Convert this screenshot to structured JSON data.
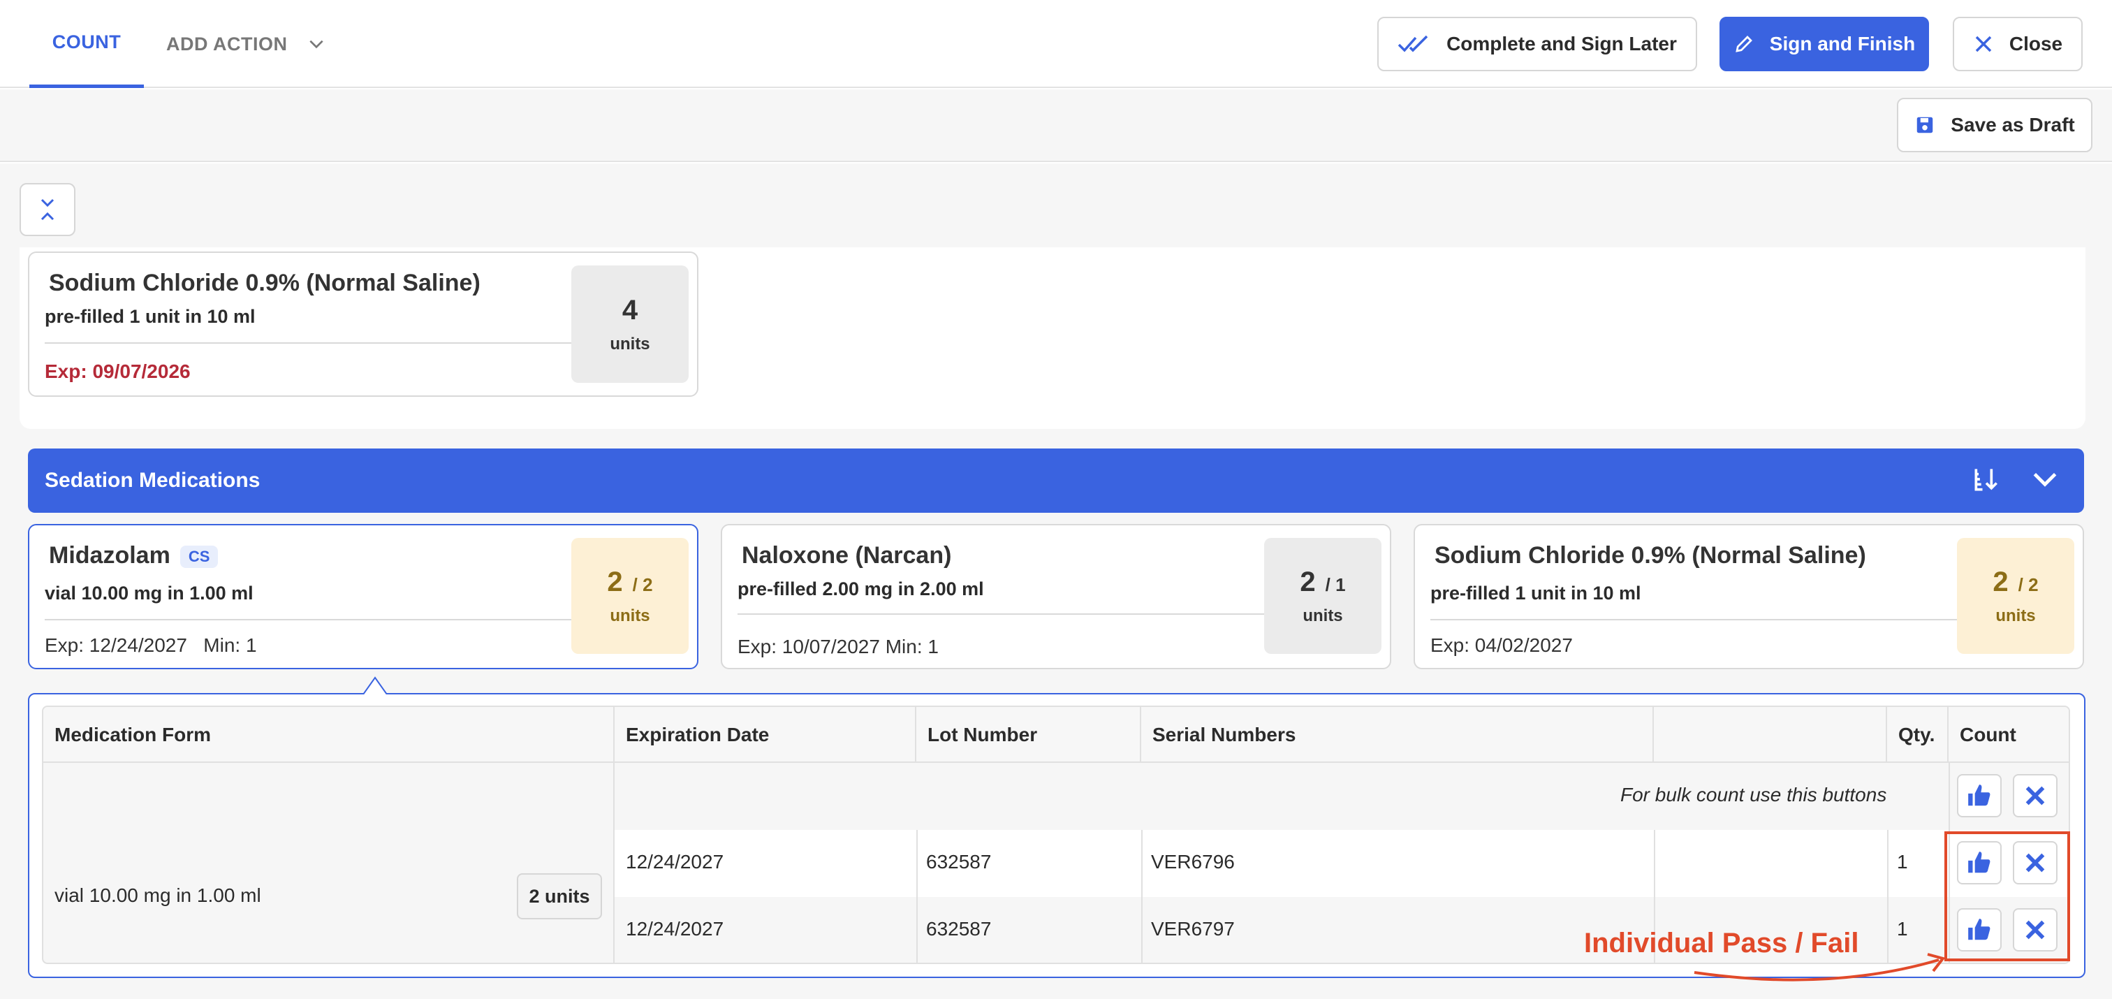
{
  "header": {
    "tabs": [
      {
        "label": "COUNT"
      },
      {
        "label": "ADD ACTION"
      }
    ],
    "complete_sign_later": "Complete and Sign Later",
    "sign_finish": "Sign and Finish",
    "close": "Close",
    "save_draft": "Save as Draft"
  },
  "top_card": {
    "name": "Sodium Chloride 0.9% (Normal Saline)",
    "form": "pre-filled 1 unit in 10 ml",
    "exp": "Exp: 09/07/2026",
    "count": "4",
    "unit_label": "units"
  },
  "section": {
    "title": "Sedation Medications"
  },
  "cards": [
    {
      "name": "Midazolam",
      "badge": "CS",
      "form": "vial 10.00 mg in 1.00 ml",
      "exp": "Exp: 12/24/2027   Min: 1",
      "count": "2",
      "of": "/ 2",
      "unit_label": "units"
    },
    {
      "name": "Naloxone (Narcan)",
      "form": "pre-filled 2.00 mg in 2.00 ml",
      "exp": "Exp: 10/07/2027 Min: 1",
      "count": "2",
      "of": "/ 1",
      "unit_label": "units"
    },
    {
      "name": "Sodium Chloride 0.9% (Normal Saline)",
      "form": "pre-filled 1 unit in 10 ml",
      "exp": "Exp: 04/02/2027",
      "count": "2",
      "of": "/ 2",
      "unit_label": "units"
    }
  ],
  "table": {
    "headers": [
      "Medication Form",
      "Expiration Date",
      "Lot Number",
      "Serial Numbers",
      "",
      "Qty.",
      "Count"
    ],
    "bulk_text": "For bulk count use this buttons",
    "med_form": "vial 10.00 mg in 1.00 ml",
    "med_units": "2 units",
    "rows": [
      {
        "exp": "12/24/2027",
        "lot": "632587",
        "serial": "VER6796",
        "qty": "1"
      },
      {
        "exp": "12/24/2027",
        "lot": "632587",
        "serial": "VER6797",
        "qty": "1"
      }
    ]
  },
  "annotation": {
    "text": "Individual Pass / Fail",
    "color": "#e14a2a"
  },
  "colors": {
    "accent": "#3a63e0",
    "expired": "#b52a38",
    "highlight_box": "#fdf0d5"
  }
}
